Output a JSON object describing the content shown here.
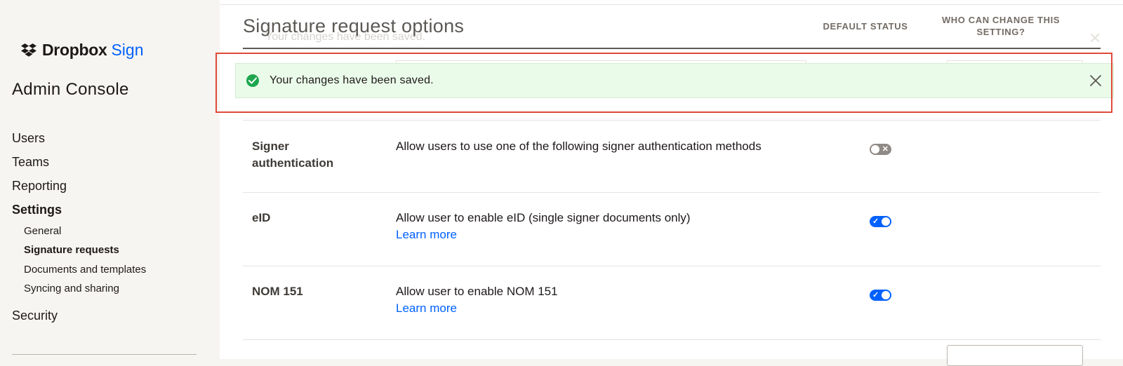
{
  "sidebar": {
    "logo_brand": "Dropbox",
    "logo_product": "Sign",
    "console_title": "Admin Console",
    "nav": {
      "users": "Users",
      "teams": "Teams",
      "reporting": "Reporting",
      "settings": "Settings",
      "security": "Security"
    },
    "settings_sub": {
      "general": "General",
      "signature_requests": "Signature requests",
      "documents_templates": "Documents and templates",
      "syncing_sharing": "Syncing and sharing"
    }
  },
  "main": {
    "title": "Signature request options",
    "columns": {
      "default_status": "DEFAULT STATUS",
      "who_can_change": "WHO CAN CHANGE THIS SETTING?"
    },
    "ghost_notice": "Your changes have been saved."
  },
  "toast": {
    "message": "Your changes have been saved.",
    "type": "success",
    "accent_color": "#1fa64f"
  },
  "rows": [
    {
      "label": "Signer authentication",
      "description": "Allow users to use one of the following signer authentication methods",
      "link": "",
      "toggle": "off"
    },
    {
      "label": "eID",
      "description": "Allow user to enable eID (single signer documents only)",
      "link": "Learn more",
      "toggle": "on"
    },
    {
      "label": "NOM 151",
      "description": "Allow user to enable NOM 151",
      "link": "Learn more",
      "toggle": "on"
    }
  ],
  "colors": {
    "brand_blue": "#0061fe",
    "highlight_red": "#e0493a",
    "toast_bg": "#eafbe9"
  }
}
